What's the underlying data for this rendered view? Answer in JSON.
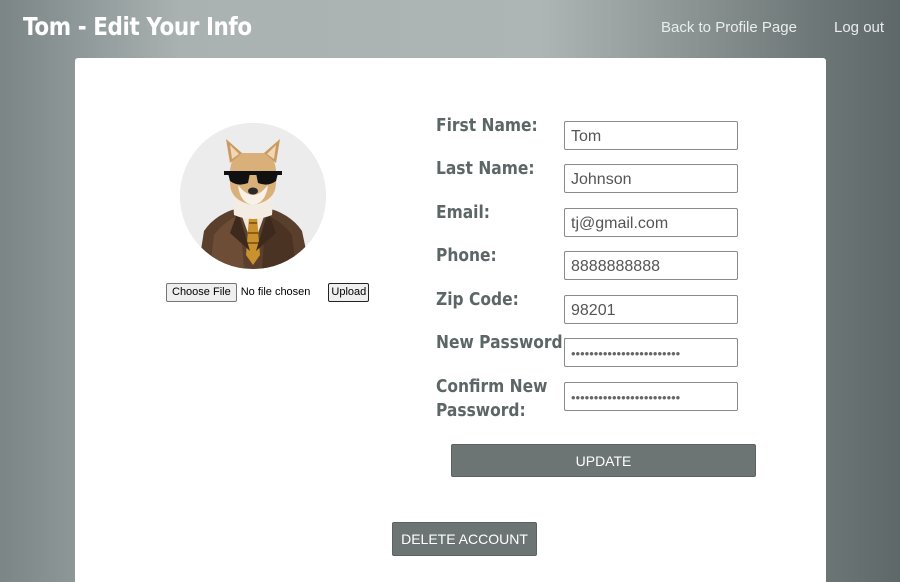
{
  "header": {
    "title": "Tom - Edit Your Info",
    "nav": {
      "back_label": "Back to Profile Page",
      "logout_label": "Log out"
    }
  },
  "avatar": {
    "icon": "dog-in-suit-avatar"
  },
  "file_upload": {
    "choose_label": "Choose File",
    "status": "No file chosen",
    "upload_label": "Upload"
  },
  "form": {
    "first_name": {
      "label": "First Name:",
      "value": "Tom"
    },
    "last_name": {
      "label": "Last Name:",
      "value": "Johnson"
    },
    "email": {
      "label": "Email:",
      "value": "tj@gmail.com"
    },
    "phone": {
      "label": "Phone:",
      "value": "8888888888"
    },
    "zip": {
      "label": "Zip Code:",
      "value": "98201"
    },
    "new_password": {
      "label": "New Password:",
      "value": "••••••••••••••••••••••••"
    },
    "confirm_password": {
      "label": "Confirm New Password:",
      "value": "••••••••••••••••••••••••"
    },
    "update_label": "UPDATE"
  },
  "account": {
    "delete_label": "DELETE ACCOUNT"
  },
  "colors": {
    "button_bg": "#6c7474",
    "label_text": "#5d6666",
    "card_bg": "#ffffff"
  }
}
